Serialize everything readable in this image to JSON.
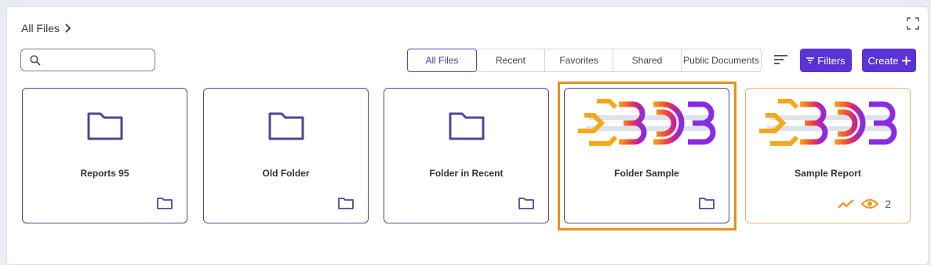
{
  "breadcrumb": {
    "root": "All Files"
  },
  "search": {
    "value": "",
    "placeholder": ""
  },
  "tabs": [
    {
      "label": "All Files",
      "active": true
    },
    {
      "label": "Recent",
      "active": false
    },
    {
      "label": "Favorites",
      "active": false
    },
    {
      "label": "Shared",
      "active": false
    },
    {
      "label": "Public Documents",
      "active": false
    }
  ],
  "toolbar": {
    "filters_label": "Filters",
    "create_label": "Create"
  },
  "items": [
    {
      "name": "Reports 95",
      "kind": "folder"
    },
    {
      "name": "Old Folder",
      "kind": "folder"
    },
    {
      "name": "Folder in Recent",
      "kind": "folder"
    },
    {
      "name": "Folder Sample",
      "kind": "folder",
      "highlighted": true
    },
    {
      "name": "Sample Report",
      "kind": "report",
      "views": "2"
    }
  ],
  "colors": {
    "accent": "#5b32d8",
    "folder_outline": "#4c4891",
    "highlight": "#e5921c",
    "report_border": "#f0b06f",
    "trend": "#e89a2e"
  }
}
